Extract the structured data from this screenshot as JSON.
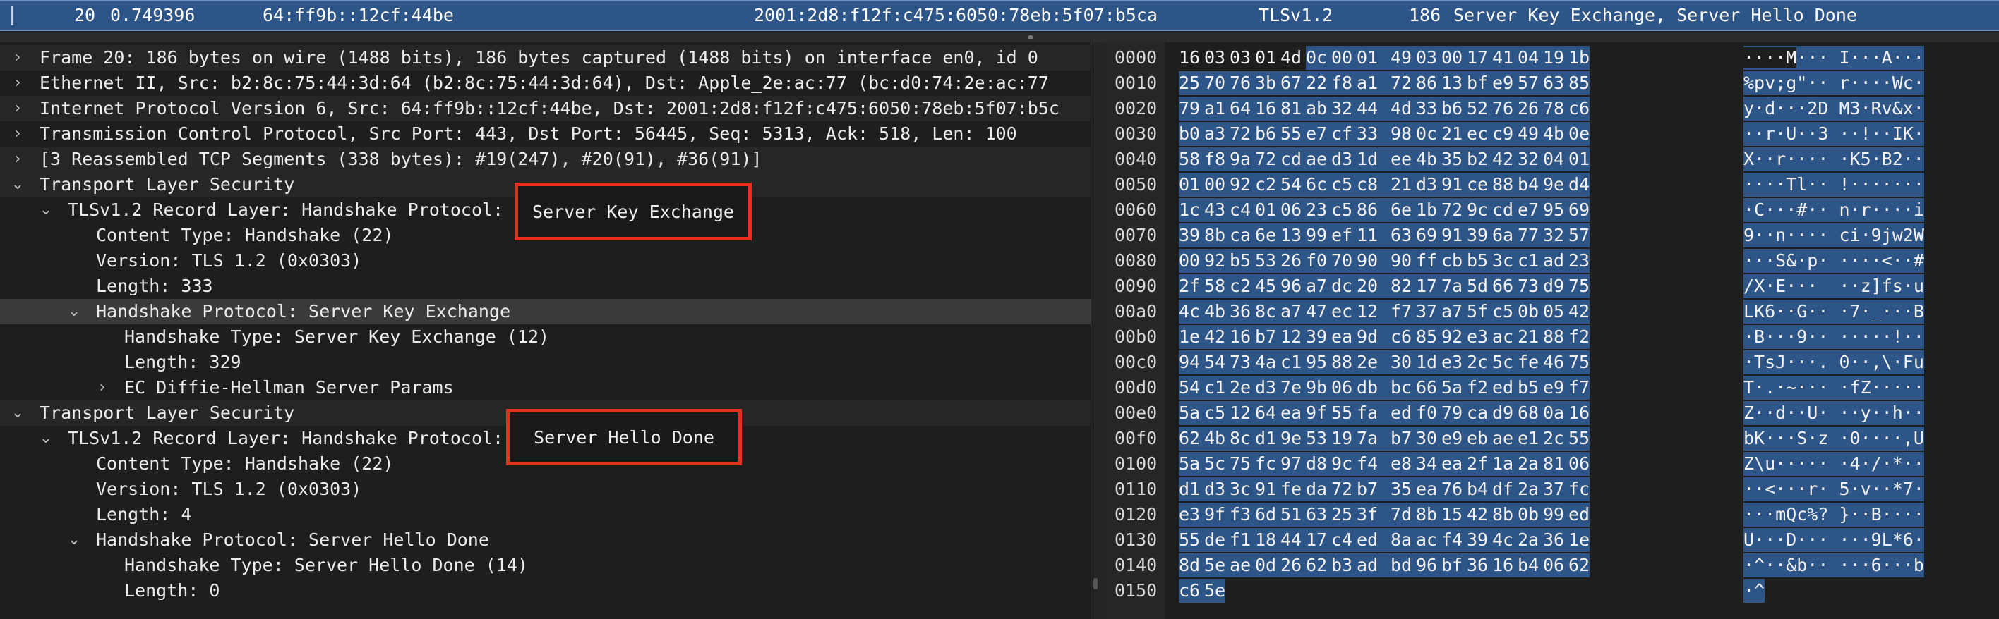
{
  "packet_row": {
    "number": "20",
    "time": "0.749396",
    "source": "64:ff9b::12cf:44be",
    "destination": "2001:2d8:f12f:c475:6050:78eb:5f07:b5ca",
    "protocol": "TLSv1.2",
    "length": "186",
    "info": "Server Key Exchange, Server Hello Done"
  },
  "details": [
    {
      "arrow": "›",
      "text": "Frame 20: 186 bytes on wire (1488 bits), 186 bytes captured (1488 bits) on interface en0, id 0"
    },
    {
      "arrow": "›",
      "text": "Ethernet II, Src: b2:8c:75:44:3d:64 (b2:8c:75:44:3d:64), Dst: Apple_2e:ac:77 (bc:d0:74:2e:ac:77"
    },
    {
      "arrow": "›",
      "text": "Internet Protocol Version 6, Src: 64:ff9b::12cf:44be, Dst: 2001:2d8:f12f:c475:6050:78eb:5f07:b5c"
    },
    {
      "arrow": "›",
      "text": "Transmission Control Protocol, Src Port: 443, Dst Port: 56445, Seq: 5313, Ack: 518, Len: 100"
    },
    {
      "arrow": "›",
      "text": "[3 Reassembled TCP Segments (338 bytes): #19(247), #20(91), #36(91)]"
    },
    {
      "arrow": "⌄",
      "text": "Transport Layer Security"
    },
    {
      "arrow": "⌄",
      "text": "TLSv1.2 Record Layer: Handshake Protocol: Server Key Exchange"
    },
    {
      "arrow": "",
      "text": "Content Type: Handshake (22)"
    },
    {
      "arrow": "",
      "text": "Version: TLS 1.2 (0x0303)"
    },
    {
      "arrow": "",
      "text": "Length: 333"
    },
    {
      "arrow": "⌄",
      "text": "Handshake Protocol: Server Key Exchange"
    },
    {
      "arrow": "",
      "text": "Handshake Type: Server Key Exchange (12)"
    },
    {
      "arrow": "",
      "text": "Length: 329"
    },
    {
      "arrow": "›",
      "text": "EC Diffie-Hellman Server Params"
    },
    {
      "arrow": "⌄",
      "text": "Transport Layer Security"
    },
    {
      "arrow": "⌄",
      "text": "TLSv1.2 Record Layer: Handshake Protocol: Server Hello Done"
    },
    {
      "arrow": "",
      "text": "Content Type: Handshake (22)"
    },
    {
      "arrow": "",
      "text": "Version: TLS 1.2 (0x0303)"
    },
    {
      "arrow": "",
      "text": "Length: 4"
    },
    {
      "arrow": "⌄",
      "text": "Handshake Protocol: Server Hello Done"
    },
    {
      "arrow": "",
      "text": "Handshake Type: Server Hello Done (14)"
    },
    {
      "arrow": "",
      "text": "Length: 0"
    }
  ],
  "annotations": {
    "box1": "Server Key Exchange",
    "box2": "Server Hello Done"
  },
  "hex_dump": [
    {
      "offset": "0000",
      "bytes": "16 03 03 01 4d 0c 00 01 49 03 00 17 41 04 19 1b",
      "ascii": "····M··· I···A···"
    },
    {
      "offset": "0010",
      "bytes": "25 70 76 3b 67 22 f8 a1 72 86 13 bf e9 57 63 85",
      "ascii": "%pv;g\"·· r····Wc·"
    },
    {
      "offset": "0020",
      "bytes": "79 a1 64 16 81 ab 32 44 4d 33 b6 52 76 26 78 c6",
      "ascii": "y·d···2D M3·Rv&x·"
    },
    {
      "offset": "0030",
      "bytes": "b0 a3 72 b6 55 e7 cf 33 98 0c 21 ec c9 49 4b 0e",
      "ascii": "··r·U··3 ··!··IK·"
    },
    {
      "offset": "0040",
      "bytes": "58 f8 9a 72 cd ae d3 1d ee 4b 35 b2 42 32 04 01",
      "ascii": "X··r···· ·K5·B2··"
    },
    {
      "offset": "0050",
      "bytes": "01 00 92 c2 54 6c c5 c8 21 d3 91 ce 88 b4 9e d4",
      "ascii": "····Tl·· !·······"
    },
    {
      "offset": "0060",
      "bytes": "1c 43 c4 01 06 23 c5 86 6e 1b 72 9c cd e7 95 69",
      "ascii": "·C···#·· n·r····i"
    },
    {
      "offset": "0070",
      "bytes": "39 8b ca 6e 13 99 ef 11 63 69 91 39 6a 77 32 57",
      "ascii": "9··n···· ci·9jw2W"
    },
    {
      "offset": "0080",
      "bytes": "00 92 b5 53 26 f0 70 90 90 ff cb b5 3c c1 ad 23",
      "ascii": "···S&·p· ····<··#"
    },
    {
      "offset": "0090",
      "bytes": "2f 58 c2 45 96 a7 dc 20 82 17 7a 5d 66 73 d9 75",
      "ascii": "/X·E···  ··z]fs·u"
    },
    {
      "offset": "00a0",
      "bytes": "4c 4b 36 8c a7 47 ec 12 f7 37 a7 5f c5 0b 05 42",
      "ascii": "LK6··G·· ·7·_···B"
    },
    {
      "offset": "00b0",
      "bytes": "1e 42 16 b7 12 39 ea 9d c6 85 92 e3 ac 21 88 f2",
      "ascii": "·B···9·· ·····!··"
    },
    {
      "offset": "00c0",
      "bytes": "94 54 73 4a c1 95 88 2e 30 1d e3 2c 5c fe 46 75",
      "ascii": "·TsJ···. 0··,\\·Fu"
    },
    {
      "offset": "00d0",
      "bytes": "54 c1 2e d3 7e 9b 06 db bc 66 5a f2 ed b5 e9 f7",
      "ascii": "T·.·~··· ·fZ·····"
    },
    {
      "offset": "00e0",
      "bytes": "5a c5 12 64 ea 9f 55 fa ed f0 79 ca d9 68 0a 16",
      "ascii": "Z··d··U· ··y··h··"
    },
    {
      "offset": "00f0",
      "bytes": "62 4b 8c d1 9e 53 19 7a b7 30 e9 eb ae e1 2c 55",
      "ascii": "bK···S·z ·0····,U"
    },
    {
      "offset": "0100",
      "bytes": "5a 5c 75 fc 97 d8 9c f4 e8 34 ea 2f 1a 2a 81 06",
      "ascii": "Z\\u····· ·4·/·*··"
    },
    {
      "offset": "0110",
      "bytes": "d1 d3 3c 91 fe da 72 b7 35 ea 76 b4 df 2a 37 fc",
      "ascii": "··<···r· 5·v··*7·"
    },
    {
      "offset": "0120",
      "bytes": "e3 9f f3 6d 51 63 25 3f 7d 8b 15 42 8b 0b 99 ed",
      "ascii": "···mQc%? }··B····"
    },
    {
      "offset": "0130",
      "bytes": "55 de f1 18 44 17 c4 ed 8a ac f4 39 4c 2a 36 1e",
      "ascii": "U···D··· ···9L*6·"
    },
    {
      "offset": "0140",
      "bytes": "8d 5e ae 0d 26 62 b3 ad bd 96 bf 36 16 b4 06 62",
      "ascii": "·^··&b·· ···6···b"
    },
    {
      "offset": "0150",
      "bytes": "c6 5e",
      "ascii": "·^"
    }
  ]
}
